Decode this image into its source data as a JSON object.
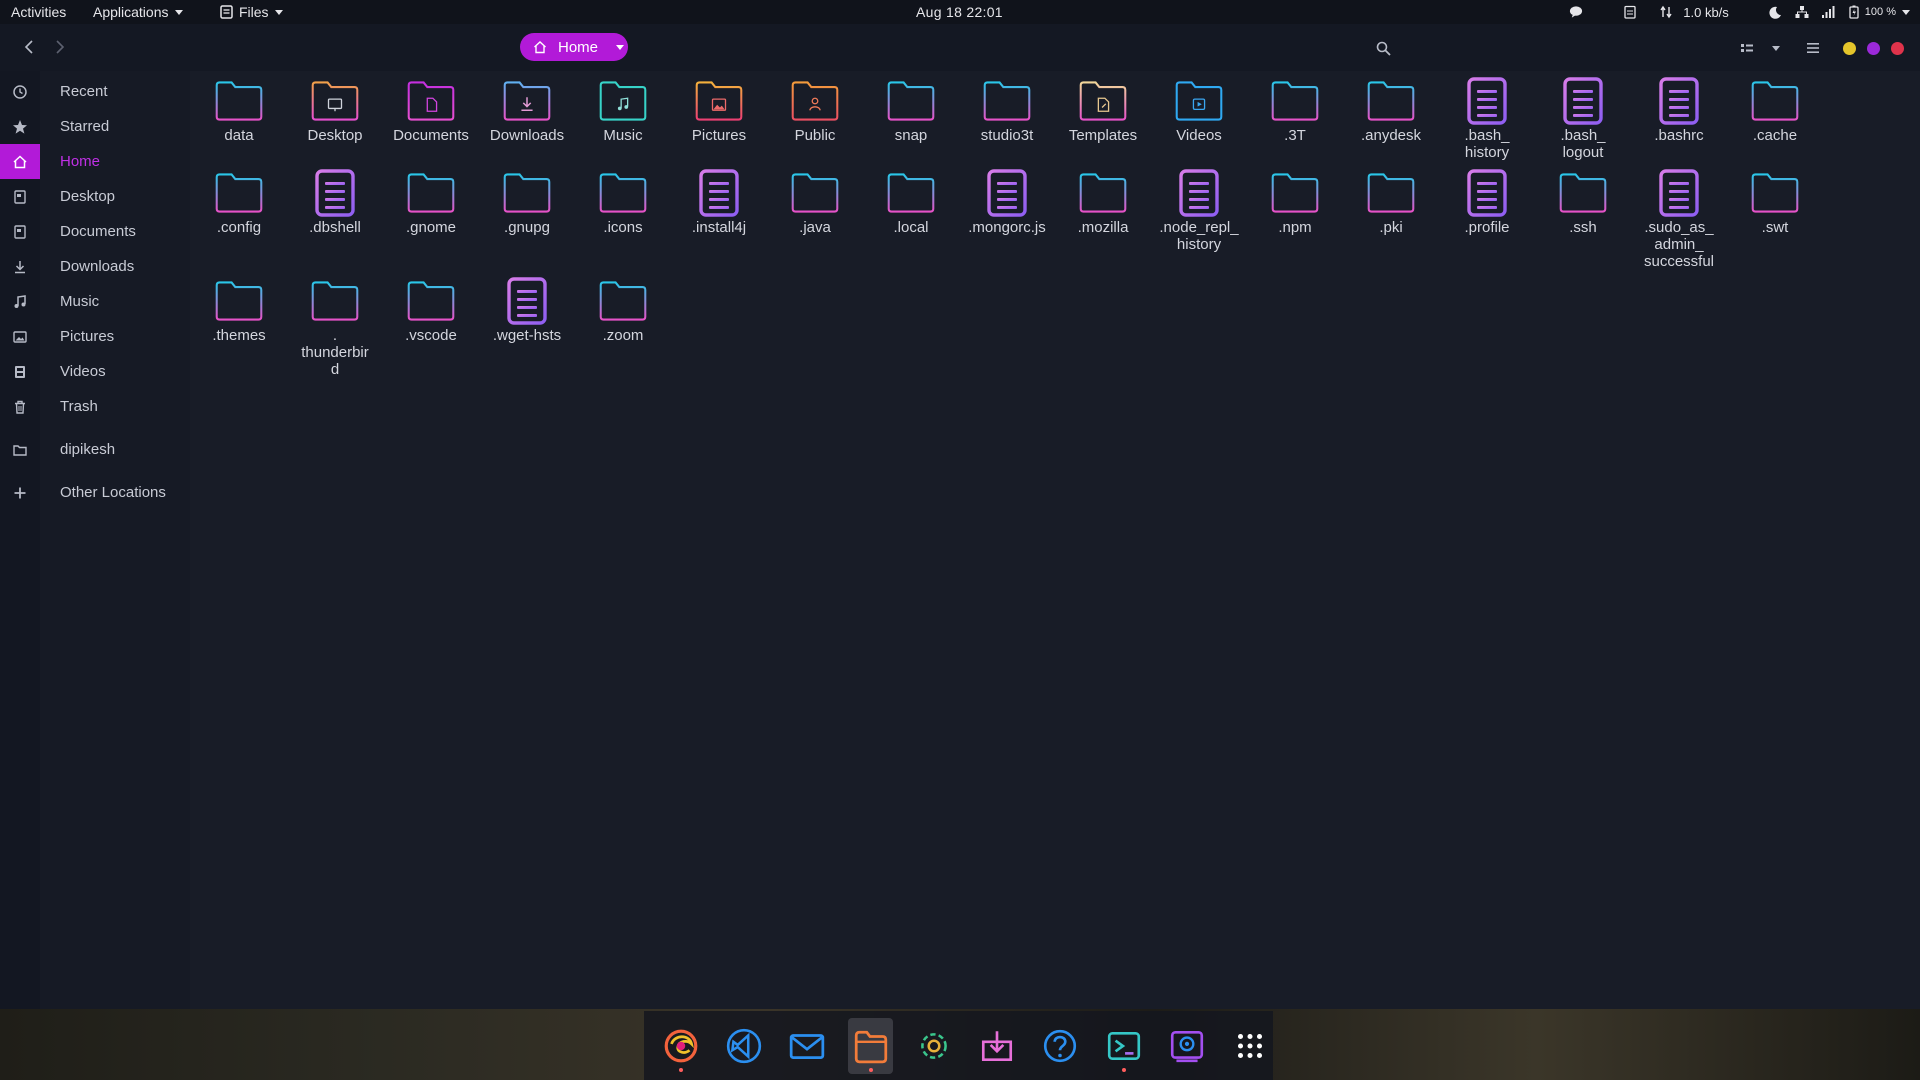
{
  "top_panel": {
    "activities": "Activities",
    "applications": "Applications",
    "files_menu": "Files",
    "clock": "Aug 18  22:01",
    "net_speed": "1.0 kb/s",
    "battery": "100 %"
  },
  "header": {
    "path_label": "Home"
  },
  "sidebar": {
    "items": [
      {
        "label": "Recent",
        "icon": "clock-icon"
      },
      {
        "label": "Starred",
        "icon": "star-icon"
      },
      {
        "label": "Home",
        "icon": "home-icon"
      },
      {
        "label": "Desktop",
        "icon": "desktop-icon"
      },
      {
        "label": "Documents",
        "icon": "document-icon"
      },
      {
        "label": "Downloads",
        "icon": "download-icon"
      },
      {
        "label": "Music",
        "icon": "music-icon"
      },
      {
        "label": "Pictures",
        "icon": "picture-icon"
      },
      {
        "label": "Videos",
        "icon": "video-icon"
      },
      {
        "label": "Trash",
        "icon": "trash-icon"
      },
      {
        "label": "dipikesh",
        "icon": "drive-icon"
      },
      {
        "label": "Other Locations",
        "icon": "plus-icon"
      }
    ]
  },
  "files": {
    "items": [
      {
        "label": "data",
        "kind": "folder"
      },
      {
        "label": "Desktop",
        "kind": "folder-desktop"
      },
      {
        "label": "Documents",
        "kind": "folder-documents"
      },
      {
        "label": "Downloads",
        "kind": "folder-downloads"
      },
      {
        "label": "Music",
        "kind": "folder-music"
      },
      {
        "label": "Pictures",
        "kind": "folder-pictures"
      },
      {
        "label": "Public",
        "kind": "folder-public"
      },
      {
        "label": "snap",
        "kind": "folder"
      },
      {
        "label": "studio3t",
        "kind": "folder"
      },
      {
        "label": "Templates",
        "kind": "folder-templates"
      },
      {
        "label": "Videos",
        "kind": "folder-videos"
      },
      {
        "label": ".3T",
        "kind": "folder"
      },
      {
        "label": ".anydesk",
        "kind": "folder"
      },
      {
        "label": ".bash_\nhistory",
        "kind": "file"
      },
      {
        "label": ".bash_\nlogout",
        "kind": "file"
      },
      {
        "label": ".bashrc",
        "kind": "file"
      },
      {
        "label": ".cache",
        "kind": "folder"
      },
      {
        "label": ".config",
        "kind": "folder"
      },
      {
        "label": ".dbshell",
        "kind": "file"
      },
      {
        "label": ".gnome",
        "kind": "folder"
      },
      {
        "label": ".gnupg",
        "kind": "folder"
      },
      {
        "label": ".icons",
        "kind": "folder"
      },
      {
        "label": ".install4j",
        "kind": "file"
      },
      {
        "label": ".java",
        "kind": "folder"
      },
      {
        "label": ".local",
        "kind": "folder"
      },
      {
        "label": ".mongorc.js",
        "kind": "file"
      },
      {
        "label": ".mozilla",
        "kind": "folder"
      },
      {
        "label": ".node_repl_\nhistory",
        "kind": "file"
      },
      {
        "label": ".npm",
        "kind": "folder"
      },
      {
        "label": ".pki",
        "kind": "folder"
      },
      {
        "label": ".profile",
        "kind": "file"
      },
      {
        "label": ".ssh",
        "kind": "folder"
      },
      {
        "label": ".sudo_as_\nadmin_\nsuccessful",
        "kind": "file"
      },
      {
        "label": ".swt",
        "kind": "folder"
      },
      {
        "label": ".themes",
        "kind": "folder"
      },
      {
        "label": ".\nthunderbir\nd",
        "kind": "folder"
      },
      {
        "label": ".vscode",
        "kind": "folder"
      },
      {
        "label": ".wget-hsts",
        "kind": "file"
      },
      {
        "label": ".zoom",
        "kind": "folder"
      }
    ]
  },
  "dock": {
    "apps": [
      {
        "name": "firefox-icon"
      },
      {
        "name": "vscode-icon"
      },
      {
        "name": "mail-icon"
      },
      {
        "name": "files-icon"
      },
      {
        "name": "settings-icon"
      },
      {
        "name": "software-install-icon"
      },
      {
        "name": "help-icon"
      },
      {
        "name": "terminal-icon"
      },
      {
        "name": "screenshot-icon"
      },
      {
        "name": "app-grid-icon"
      }
    ]
  },
  "colors": {
    "accent": "#b21ad8",
    "folder_cyan": "#29c6e8",
    "folder_pink": "#e652c8",
    "file_purple": "#b06af0"
  }
}
